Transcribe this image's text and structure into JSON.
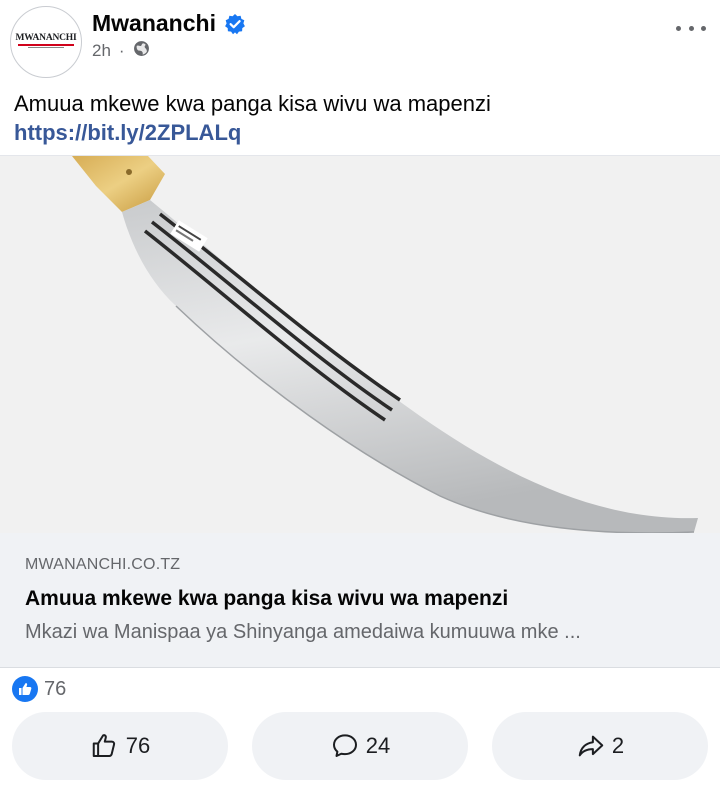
{
  "post": {
    "page_name": "Mwananchi",
    "logo_text": "MWANANCHI",
    "time": "2h",
    "separator": "·",
    "text": "Amuua mkewe kwa panga kisa wivu wa mapenzi ",
    "link_text": "https://bit.ly/2ZPLALq"
  },
  "link_preview": {
    "domain": "MWANANCHI.CO.TZ",
    "title": "Amuua mkewe kwa panga kisa wivu wa mapenzi",
    "description": "Mkazi wa Manispaa ya Shinyanga amedaiwa kumuuwa mke ..."
  },
  "stats": {
    "reaction_count": "76"
  },
  "actions": {
    "like_count": "76",
    "comment_count": "24",
    "share_count": "2"
  },
  "colors": {
    "verified": "#1877f2",
    "link": "#385898",
    "muted": "#65676b"
  },
  "icons": [
    "verified-badge-icon",
    "globe-icon",
    "more-options-icon",
    "like-reaction-icon",
    "thumbs-up-icon",
    "comment-icon",
    "share-icon"
  ]
}
